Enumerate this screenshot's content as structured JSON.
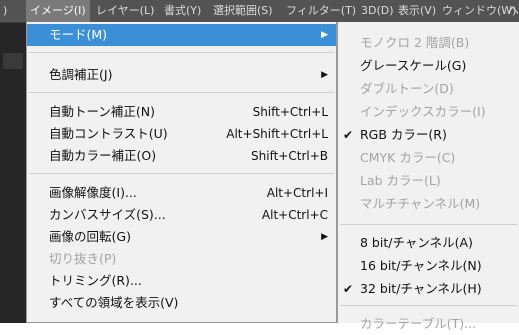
{
  "menubar": {
    "left_fragment": ")",
    "items": [
      {
        "label": "イメージ(I)"
      },
      {
        "label": "レイヤー(L)"
      },
      {
        "label": "書式(Y)"
      },
      {
        "label": "選択範囲(S)"
      },
      {
        "label": "フィルター(T)"
      },
      {
        "label": "3D(D)"
      },
      {
        "label": "表示(V)"
      },
      {
        "label": "ウィンドウ(W)"
      },
      {
        "label": "ヘ"
      }
    ]
  },
  "image_menu": {
    "items": [
      {
        "label": "モード(M)",
        "submenu_arrow": "▶"
      },
      {
        "label": "色調補正(J)",
        "submenu_arrow": "▶"
      },
      {
        "label": "自動トーン補正(N)",
        "shortcut": "Shift+Ctrl+L"
      },
      {
        "label": "自動コントラスト(U)",
        "shortcut": "Alt+Shift+Ctrl+L"
      },
      {
        "label": "自動カラー補正(O)",
        "shortcut": "Shift+Ctrl+B"
      },
      {
        "label": "画像解像度(I)...",
        "shortcut": "Alt+Ctrl+I"
      },
      {
        "label": "カンバスサイズ(S)...",
        "shortcut": "Alt+Ctrl+C"
      },
      {
        "label": "画像の回転(G)",
        "submenu_arrow": "▶"
      },
      {
        "label": "切り抜き(P)"
      },
      {
        "label": "トリミング(R)..."
      },
      {
        "label": "すべての領域を表示(V)"
      }
    ]
  },
  "mode_submenu": {
    "check_glyph": "✔",
    "items": [
      {
        "label": "モノクロ 2 階調(B)"
      },
      {
        "label": "グレースケール(G)"
      },
      {
        "label": "ダブルトーン(D)"
      },
      {
        "label": "インデックスカラー(I)"
      },
      {
        "label": "RGB カラー(R)"
      },
      {
        "label": "CMYK カラー(C)"
      },
      {
        "label": "Lab カラー(L)"
      },
      {
        "label": "マルチチャンネル(M)"
      },
      {
        "label": "8 bit/チャンネル(A)"
      },
      {
        "label": "16 bit/チャンネル(N)"
      },
      {
        "label": "32 bit/チャンネル(H)"
      },
      {
        "label": "カラーテーブル(T)..."
      }
    ]
  },
  "colors": {
    "menubar_bg": "#535353",
    "menu_bg": "#f1f1f1",
    "highlight": "#3b8fd6",
    "disabled_text": "#a3a3a3"
  }
}
